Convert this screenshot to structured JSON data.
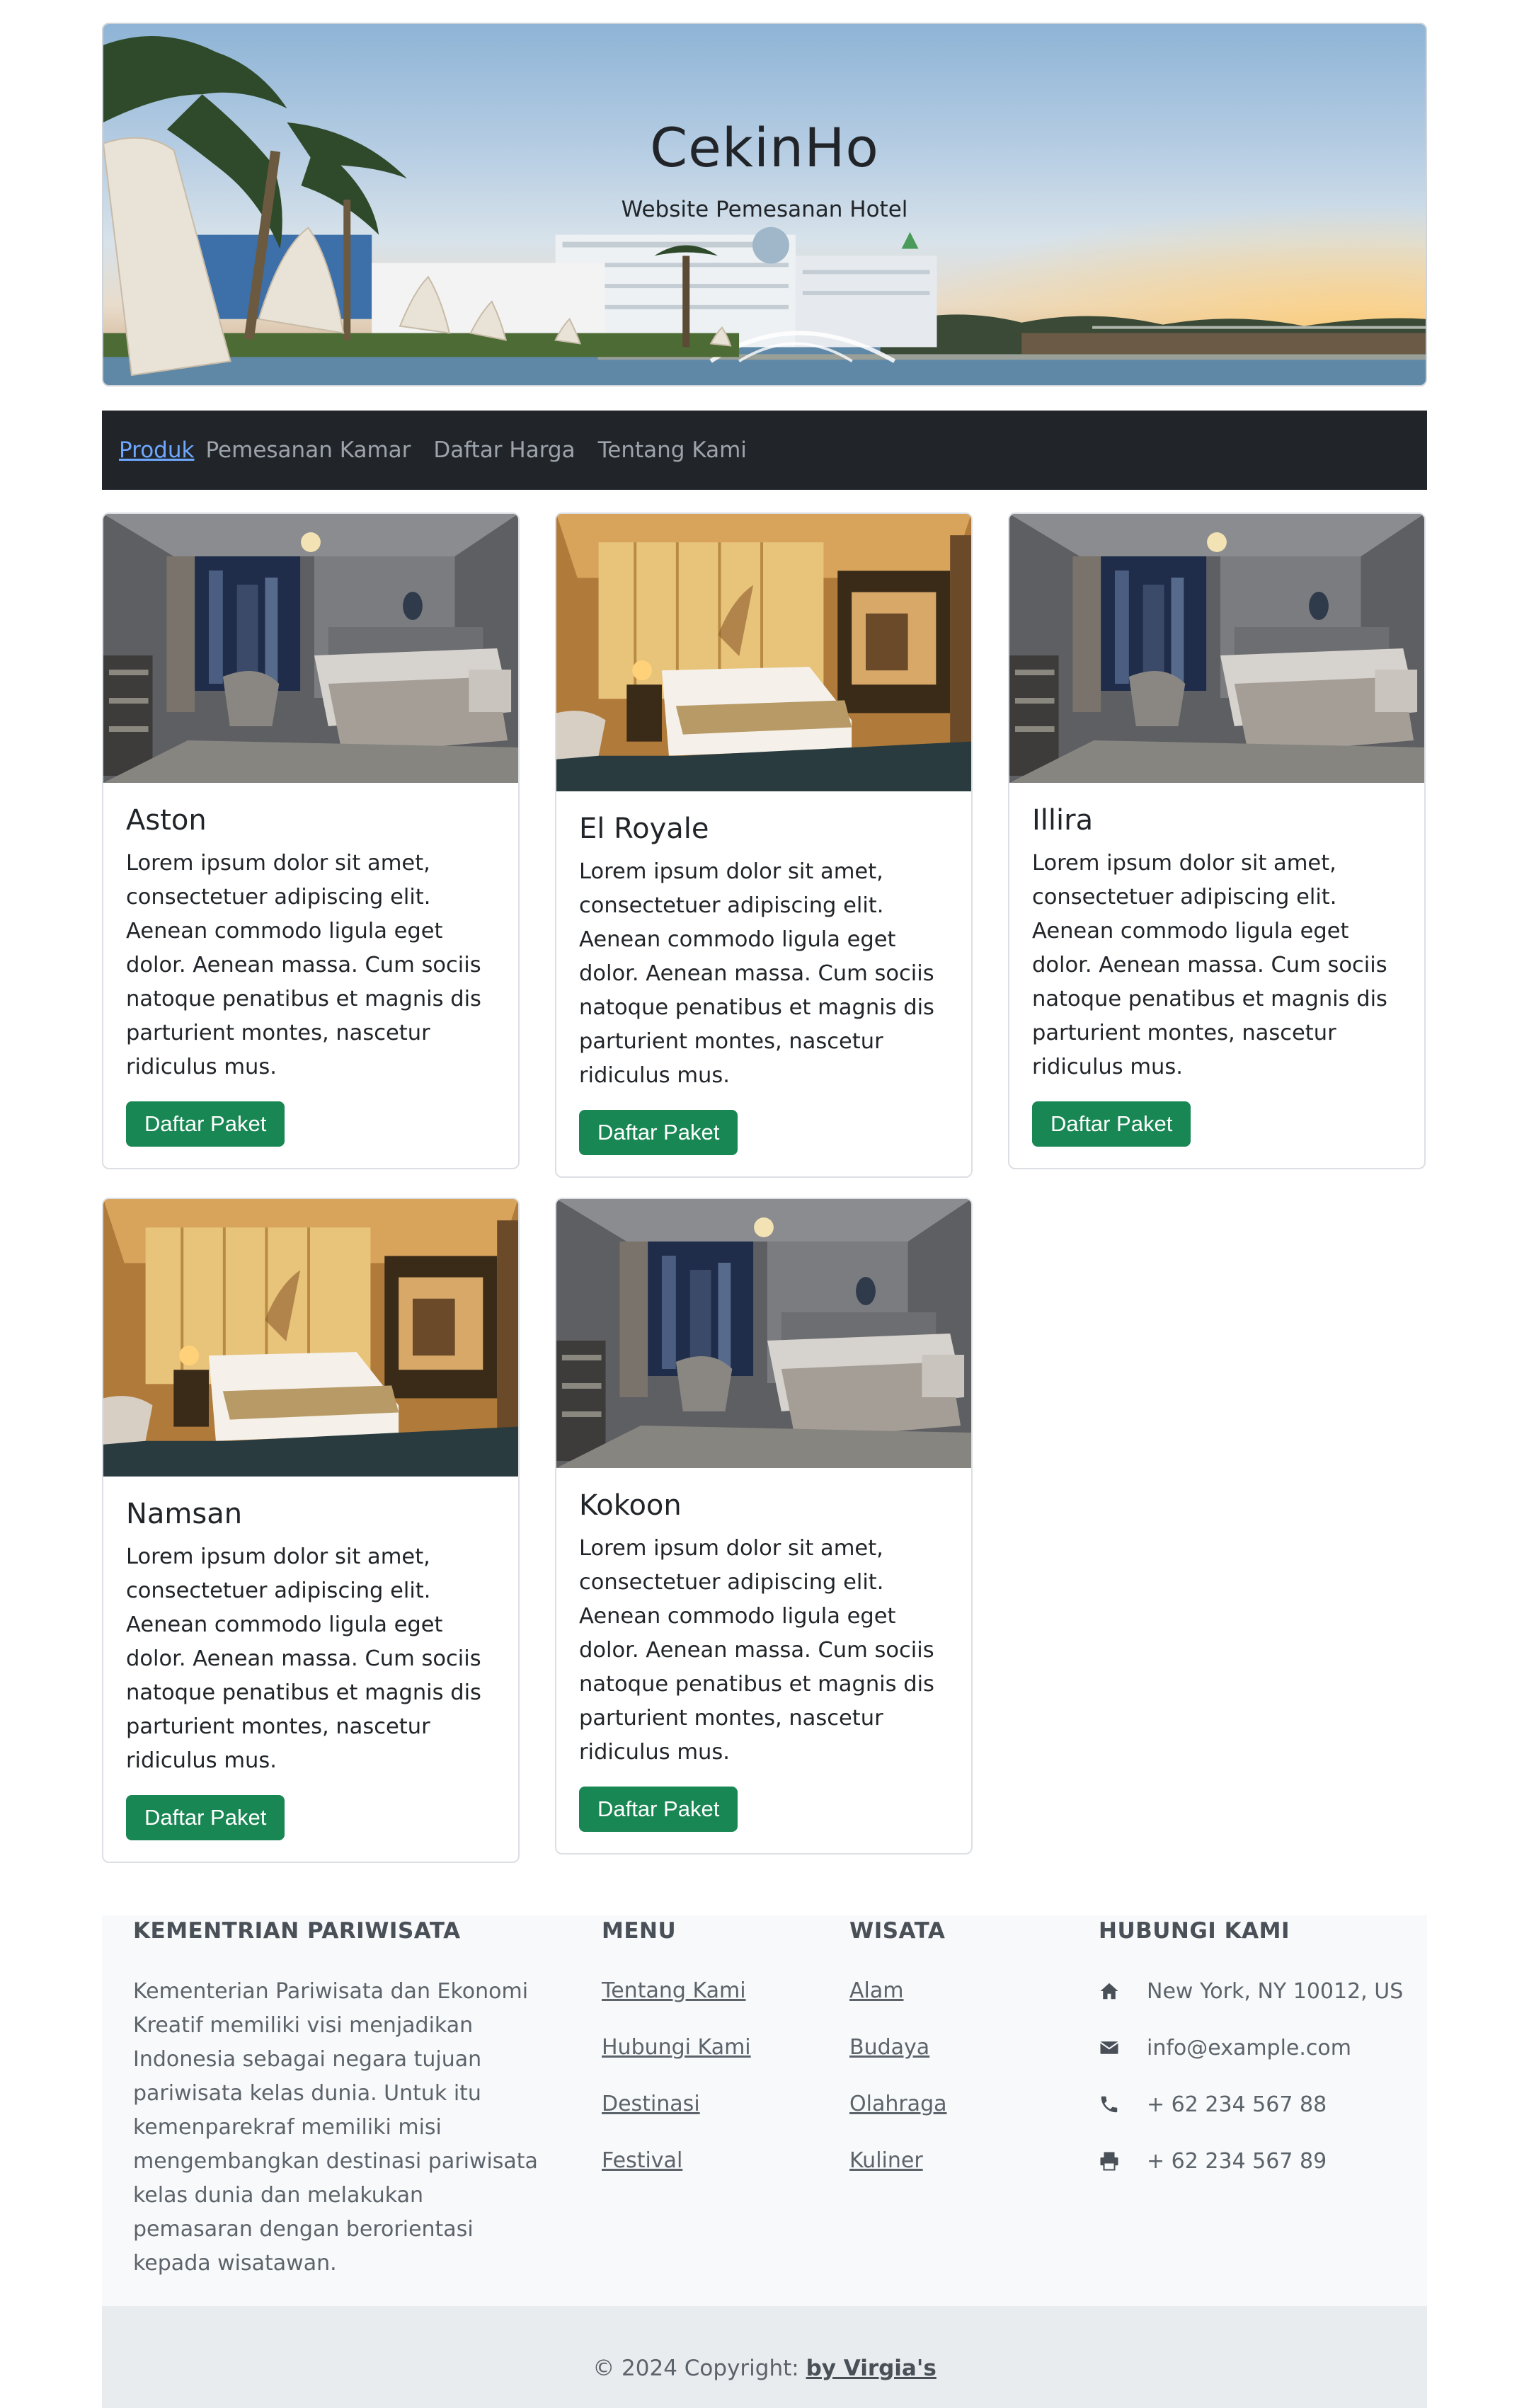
{
  "hero": {
    "title": "CekinHo",
    "subtitle": "Website Pemesanan Hotel"
  },
  "nav": {
    "items": [
      "Produk",
      "Pemesanan Kamar",
      "Daftar Harga",
      "Tentang Kami"
    ]
  },
  "cards": [
    {
      "title": "Aston",
      "text": "Lorem ipsum dolor sit amet, consectetuer adipiscing elit. Aenean commodo ligula eget dolor. Aenean massa. Cum sociis natoque penatibus et magnis dis parturient montes, nascetur ridiculus mus.",
      "button": "Daftar Paket",
      "image": "grey-hotel-room"
    },
    {
      "title": "El Royale",
      "text": "Lorem ipsum dolor sit amet, consectetuer adipiscing elit. Aenean commodo ligula eget dolor. Aenean massa. Cum sociis natoque penatibus et magnis dis parturient montes, nascetur ridiculus mus.",
      "button": "Daftar Paket",
      "image": "warm-hotel-room"
    },
    {
      "title": "Illira",
      "text": "Lorem ipsum dolor sit amet, consectetuer adipiscing elit. Aenean commodo ligula eget dolor. Aenean massa. Cum sociis natoque penatibus et magnis dis parturient montes, nascetur ridiculus mus.",
      "button": "Daftar Paket",
      "image": "grey-hotel-room"
    },
    {
      "title": "Namsan",
      "text": "Lorem ipsum dolor sit amet, consectetuer adipiscing elit. Aenean commodo ligula eget dolor. Aenean massa. Cum sociis natoque penatibus et magnis dis parturient montes, nascetur ridiculus mus.",
      "button": "Daftar Paket",
      "image": "warm-hotel-room"
    },
    {
      "title": "Kokoon",
      "text": "Lorem ipsum dolor sit amet, consectetuer adipiscing elit. Aenean commodo ligula eget dolor. Aenean massa. Cum sociis natoque penatibus et magnis dis parturient montes, nascetur ridiculus mus.",
      "button": "Daftar Paket",
      "image": "grey-hotel-room"
    }
  ],
  "footer": {
    "about": {
      "heading": "KEMENTRIAN PARIWISATA",
      "text": "Kementerian Pariwisata dan Ekonomi Kreatif memiliki visi menjadikan Indonesia sebagai negara tujuan pariwisata kelas dunia. Untuk itu kemenparekraf memiliki misi mengembangkan destinasi pariwisata kelas dunia dan melakukan pemasaran dengan berorientasi kepada wisatawan."
    },
    "menu": {
      "heading": "MENU",
      "links": [
        "Tentang Kami",
        "Hubungi Kami",
        "Destinasi",
        "Festival"
      ]
    },
    "wisata": {
      "heading": "WISATA",
      "links": [
        "Alam",
        "Budaya",
        "Olahraga",
        "Kuliner"
      ]
    },
    "contact": {
      "heading": "HUBUNGI KAMI",
      "items": [
        {
          "icon": "home-icon",
          "text": "New York, NY 10012, US"
        },
        {
          "icon": "envelope-icon",
          "text": "info@example.com"
        },
        {
          "icon": "phone-icon",
          "text": "+ 62 234 567 88"
        },
        {
          "icon": "print-icon",
          "text": "+ 62 234 567 89"
        }
      ]
    }
  },
  "copyright": {
    "prefix": "© 2024 Copyright: ",
    "author": "by Virgia's"
  }
}
